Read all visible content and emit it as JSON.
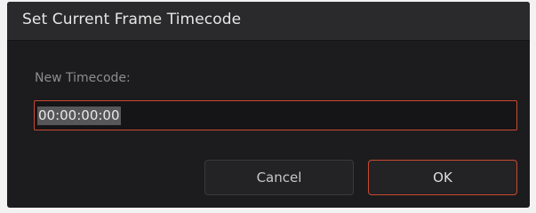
{
  "dialog": {
    "title": "Set Current Frame Timecode",
    "label": "New Timecode:",
    "timecode_value": "00:00:00:00",
    "cancel_label": "Cancel",
    "ok_label": "OK"
  },
  "colors": {
    "background": "#1c1c1e",
    "titlebar": "#2a2a2c",
    "accent_border": "#c94a2f",
    "text": "#e6e6e6",
    "label_text": "#8d8d8f"
  }
}
